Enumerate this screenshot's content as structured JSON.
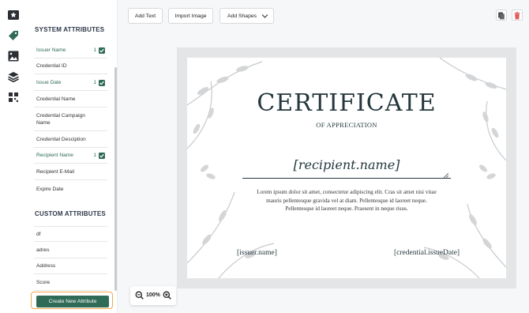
{
  "rail": {
    "icons": [
      "star-badge-icon",
      "tag-icon",
      "image-icon",
      "layers-icon",
      "grid-icon"
    ]
  },
  "sidebar": {
    "system_title": "SYSTEM ATTRIBUTES",
    "system_items": [
      {
        "label": "Issuer Name",
        "count": "1",
        "checked": true
      },
      {
        "label": "Credential ID",
        "count": "",
        "checked": false
      },
      {
        "label": "Issue Date",
        "count": "1",
        "checked": true
      },
      {
        "label": "Credential Name",
        "count": "",
        "checked": false
      },
      {
        "label": "Credential Campaign Name",
        "count": "",
        "checked": false
      },
      {
        "label": "Credential Desciption",
        "count": "",
        "checked": false
      },
      {
        "label": "Recipient Name",
        "count": "1",
        "checked": true
      },
      {
        "label": "Recipient E-Mail",
        "count": "",
        "checked": false
      },
      {
        "label": "Expire Date",
        "count": "",
        "checked": false
      }
    ],
    "custom_title": "CUSTOM ATTRIBUTES",
    "custom_items": [
      {
        "label": "df"
      },
      {
        "label": "adres"
      },
      {
        "label": "Address"
      },
      {
        "label": "Score"
      }
    ],
    "create_label": "Create New Attribute"
  },
  "toolbar": {
    "add_text": "Add Text",
    "import_image": "Import Image",
    "add_shapes": "Add Shapes"
  },
  "certificate": {
    "title": "CERTIFICATE",
    "subtitle": "OF APPRECIATION",
    "recipient": "[recipient.name]",
    "body": "Lorem ipsum dolor sit amet, consectetur adipiscing elit. Cras sit amet nisi vitae mauris pellentesque gravida vel at diam. Pellentesque id laoreet neque. Pellentesque id laoreet neque. Praesent in neque risus.",
    "issuer": "[issuer.name]",
    "issue_date": "[credential.issueDate]"
  },
  "zoom": {
    "level": "100%"
  },
  "colors": {
    "accent": "#2f6b57",
    "highlight": "#f0a94b",
    "danger": "#e05a5a"
  }
}
